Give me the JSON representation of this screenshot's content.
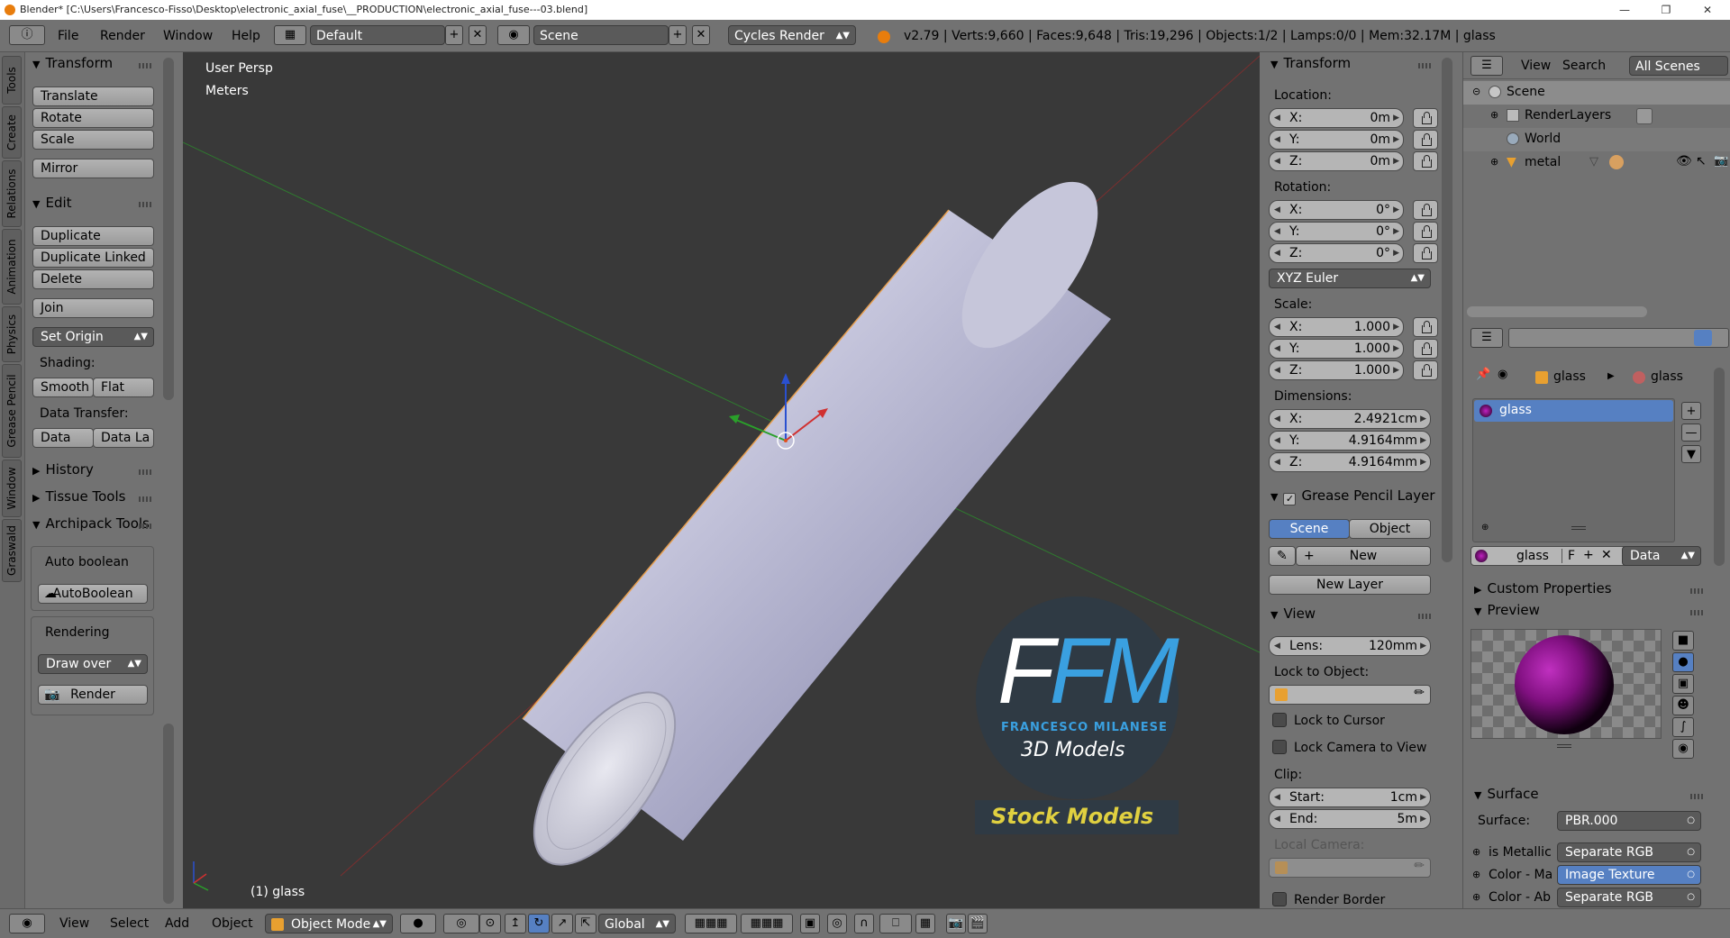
{
  "window": {
    "title": "Blender* [C:\\Users\\Francesco-Fisso\\Desktop\\electronic_axial_fuse\\__PRODUCTION\\electronic_axial_fuse---03.blend]"
  },
  "header": {
    "menus": [
      "File",
      "Render",
      "Window",
      "Help"
    ],
    "screen_layout": "Default",
    "scene": "Scene",
    "render_engine": "Cycles Render",
    "stats": "v2.79 | Verts:9,660 | Faces:9,648 | Tris:19,296 | Objects:1/2 | Lamps:0/0 | Mem:32.17M | glass"
  },
  "toolshelf": {
    "tabs": [
      "Tools",
      "Create",
      "Relations",
      "Animation",
      "Physics",
      "Grease Pencil",
      "Window",
      "Graswald"
    ],
    "transform": {
      "title": "Transform",
      "buttons": [
        "Translate",
        "Rotate",
        "Scale",
        "Mirror"
      ]
    },
    "edit": {
      "title": "Edit",
      "buttons": [
        "Duplicate",
        "Duplicate Linked",
        "Delete",
        "Join"
      ],
      "set_origin": "Set Origin",
      "shading_label": "Shading:",
      "smooth": "Smooth",
      "flat": "Flat",
      "data_transfer_label": "Data Transfer:",
      "data": "Data",
      "data_la": "Data La"
    },
    "history": "History",
    "tissue_tools": "Tissue Tools",
    "archipack": "Archipack Tools",
    "auto_boolean_label": "Auto boolean",
    "autoboolean_btn": "AutoBoolean",
    "rendering_label": "Rendering",
    "draw_over": "Draw over",
    "render_btn": "Render"
  },
  "viewport": {
    "view_name": "User Persp",
    "units": "Meters",
    "object_label": "(1) glass",
    "watermark": {
      "logo": "FM",
      "brand": "FRANCESCO MILANESE",
      "sub": "3D Models",
      "banner": "Stock Models"
    }
  },
  "npanel": {
    "transform_title": "Transform",
    "location_label": "Location:",
    "location": [
      {
        "axis": "X:",
        "value": "0m"
      },
      {
        "axis": "Y:",
        "value": "0m"
      },
      {
        "axis": "Z:",
        "value": "0m"
      }
    ],
    "rotation_label": "Rotation:",
    "rotation": [
      {
        "axis": "X:",
        "value": "0°"
      },
      {
        "axis": "Y:",
        "value": "0°"
      },
      {
        "axis": "Z:",
        "value": "0°"
      }
    ],
    "rotation_mode": "XYZ Euler",
    "scale_label": "Scale:",
    "scale": [
      {
        "axis": "X:",
        "value": "1.000"
      },
      {
        "axis": "Y:",
        "value": "1.000"
      },
      {
        "axis": "Z:",
        "value": "1.000"
      }
    ],
    "dimensions_label": "Dimensions:",
    "dimensions": [
      {
        "axis": "X:",
        "value": "2.4921cm"
      },
      {
        "axis": "Y:",
        "value": "4.9164mm"
      },
      {
        "axis": "Z:",
        "value": "4.9164mm"
      }
    ],
    "grease_pencil_title": "Grease Pencil Layer",
    "gp_scene": "Scene",
    "gp_object": "Object",
    "gp_new": "New",
    "gp_new_layer": "New Layer",
    "view_title": "View",
    "lens_label": "Lens:",
    "lens_value": "120mm",
    "lock_to_object": "Lock to Object:",
    "lock_to_cursor": "Lock to Cursor",
    "lock_camera": "Lock Camera to View",
    "clip_label": "Clip:",
    "clip_start_label": "Start:",
    "clip_start": "1cm",
    "clip_end_label": "End:",
    "clip_end": "5m",
    "local_camera": "Local Camera:",
    "render_border": "Render Border"
  },
  "outliner": {
    "view": "View",
    "search": "Search",
    "filter": "All Scenes",
    "items": [
      "Scene",
      "RenderLayers",
      "World",
      "metal"
    ]
  },
  "properties": {
    "breadcrumb": [
      "glass",
      "glass"
    ],
    "material_slot": "glass",
    "material_name": "glass",
    "f_label": "F",
    "data_select": "Data",
    "custom_properties": "Custom Properties",
    "preview": "Preview",
    "surface_title": "Surface",
    "surface_label": "Surface:",
    "surface_value": "PBR.000",
    "inputs": [
      {
        "label": "is Metallic",
        "value": "Separate RGB"
      },
      {
        "label": "Color - Ma",
        "value": "Image Texture"
      },
      {
        "label": "Color - Ab",
        "value": "Separate RGB"
      }
    ]
  },
  "bottombar": {
    "menus": [
      "View",
      "Select",
      "Add",
      "Object"
    ],
    "mode": "Object Mode",
    "orientation": "Global"
  },
  "colors": {
    "ui_gray": "#727272",
    "viewport": "#393939",
    "selected_blue": "#5680c2",
    "accent_orange": "#e87d0d"
  }
}
